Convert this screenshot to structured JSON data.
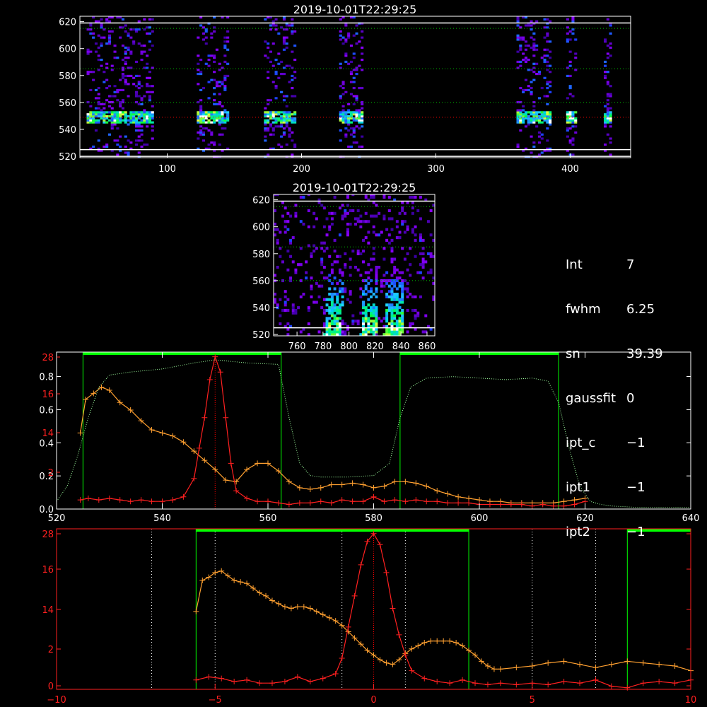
{
  "info_panel": [
    {
      "label": "Int",
      "value": "7"
    },
    {
      "label": "fwhm",
      "value": "6.25"
    },
    {
      "label": "sn",
      "value": "39.39"
    },
    {
      "label": "gaussfit",
      "value": "0"
    },
    {
      "label": "ipt_c",
      "value": "−1"
    },
    {
      "label": "ipt1",
      "value": "−1"
    },
    {
      "label": "ipt2",
      "value": "−1"
    }
  ],
  "colors": {
    "background": "#000000",
    "axes": "#ffffff",
    "grid": "#00c000",
    "red": "#ff2020",
    "orange": "#ffa030",
    "green": "#00ff00",
    "band": "#ff0000"
  },
  "chart_data": [
    {
      "type": "heatmap",
      "title": "2019-10-01T22:29:25",
      "xlim": [
        35,
        445
      ],
      "ylim": [
        519,
        624
      ],
      "xticks": [
        100,
        200,
        300,
        400
      ],
      "yticks": [
        520,
        540,
        560,
        580,
        600,
        620
      ],
      "hlines_white": [
        520,
        525,
        619
      ],
      "hlines_green_dotted": [
        560,
        585,
        615
      ],
      "hline_red_dotted": 549,
      "strips": [
        [
          40,
          90
        ],
        [
          122,
          146
        ],
        [
          172,
          196
        ],
        [
          228,
          246
        ],
        [
          360,
          386
        ],
        [
          397,
          404
        ],
        [
          425,
          430
        ]
      ],
      "core_y": [
        544,
        552
      ],
      "colormap": "rainbow"
    },
    {
      "type": "heatmap",
      "title": "2019-10-01T22:29:25",
      "xlim": [
        742,
        866
      ],
      "ylim": [
        519,
        624
      ],
      "xticks": [
        760,
        780,
        800,
        820,
        840,
        860
      ],
      "yticks": [
        520,
        540,
        560,
        580,
        600,
        620
      ],
      "hlines_white": [
        525,
        619
      ],
      "hlines_green_dotted": [
        560,
        585,
        615
      ],
      "bright_streaks": [
        [
          780,
          793
        ],
        [
          808,
          820
        ],
        [
          826,
          840
        ]
      ],
      "colormap": "rainbow"
    },
    {
      "type": "line",
      "xlim": [
        520,
        640
      ],
      "xticks": [
        520,
        540,
        560,
        580,
        600,
        620,
        640
      ],
      "yticks_left_white": [
        "0.0",
        "0.2",
        "0.4",
        "0.6",
        "0.8"
      ],
      "yticks_left_red": [
        "2",
        "14",
        "16",
        "28"
      ],
      "green_spans": [
        [
          525,
          562.5
        ],
        [
          585,
          615
        ]
      ],
      "green_span_top": 1.0,
      "band_center": 550,
      "series": [
        {
          "color": "orange",
          "marker": "plus",
          "x": [
            524.5,
            525.5,
            527,
            528.5,
            530,
            532,
            534,
            536,
            538,
            540,
            542,
            544,
            546,
            548,
            550,
            552,
            554,
            556,
            558,
            560,
            562,
            564,
            566,
            568,
            570,
            572,
            574,
            576,
            578,
            580,
            582,
            584,
            586,
            588,
            590,
            592,
            594,
            596,
            598,
            600,
            602,
            604,
            606,
            608,
            610,
            612,
            614,
            616,
            618,
            620
          ],
          "y": [
            0.5,
            0.72,
            0.76,
            0.8,
            0.78,
            0.7,
            0.65,
            0.58,
            0.52,
            0.5,
            0.48,
            0.44,
            0.38,
            0.32,
            0.26,
            0.19,
            0.18,
            0.26,
            0.3,
            0.3,
            0.25,
            0.18,
            0.14,
            0.13,
            0.14,
            0.16,
            0.16,
            0.17,
            0.16,
            0.14,
            0.15,
            0.18,
            0.18,
            0.17,
            0.15,
            0.12,
            0.1,
            0.08,
            0.07,
            0.06,
            0.05,
            0.05,
            0.04,
            0.04,
            0.04,
            0.04,
            0.04,
            0.05,
            0.06,
            0.07
          ]
        },
        {
          "color": "red",
          "marker": "plus",
          "x": [
            524.5,
            526,
            528,
            530,
            532,
            534,
            536,
            538,
            540,
            542,
            544,
            546,
            547,
            548,
            549,
            550,
            551,
            552,
            553,
            554,
            556,
            558,
            560,
            562,
            564,
            566,
            568,
            570,
            572,
            574,
            576,
            578,
            580,
            582,
            584,
            586,
            588,
            590,
            592,
            594,
            596,
            598,
            600,
            602,
            604,
            606,
            608,
            610,
            612,
            614,
            616,
            618,
            620
          ],
          "y": [
            0.06,
            0.07,
            0.06,
            0.07,
            0.06,
            0.05,
            0.06,
            0.05,
            0.05,
            0.06,
            0.08,
            0.2,
            0.4,
            0.6,
            0.85,
            1.0,
            0.9,
            0.6,
            0.3,
            0.12,
            0.07,
            0.05,
            0.05,
            0.04,
            0.03,
            0.04,
            0.04,
            0.05,
            0.04,
            0.06,
            0.05,
            0.05,
            0.08,
            0.05,
            0.06,
            0.05,
            0.06,
            0.05,
            0.05,
            0.04,
            0.04,
            0.04,
            0.03,
            0.03,
            0.03,
            0.03,
            0.03,
            0.02,
            0.03,
            0.02,
            0.02,
            0.03,
            0.05
          ]
        },
        {
          "color": "green",
          "style": "dotted",
          "x": [
            520,
            522,
            524,
            526,
            528,
            530,
            534,
            540,
            546,
            550,
            556,
            562,
            564,
            566,
            568,
            570,
            575,
            580,
            583,
            585,
            587,
            590,
            595,
            600,
            605,
            610,
            613,
            615,
            617,
            619,
            621,
            623,
            625,
            630,
            635,
            640
          ],
          "y": [
            0.05,
            0.15,
            0.35,
            0.6,
            0.8,
            0.88,
            0.9,
            0.92,
            0.96,
            0.98,
            0.96,
            0.95,
            0.6,
            0.3,
            0.22,
            0.21,
            0.21,
            0.22,
            0.3,
            0.6,
            0.8,
            0.86,
            0.87,
            0.86,
            0.85,
            0.86,
            0.84,
            0.7,
            0.4,
            0.15,
            0.05,
            0.03,
            0.02,
            0.01,
            0.01,
            0.01
          ]
        }
      ]
    },
    {
      "type": "line",
      "xlim": [
        -10,
        10
      ],
      "xticks": [
        -10,
        -5,
        0,
        5,
        10
      ],
      "yticks_left_red": [
        "0",
        "2",
        "14",
        "16",
        "28"
      ],
      "green_spans": [
        [
          -5.6,
          3
        ],
        [
          8,
          10
        ]
      ],
      "white_dotted_x": [
        -7,
        -5,
        -1,
        1,
        5,
        7
      ],
      "red_dotted_x": 0,
      "series": [
        {
          "color": "orange",
          "marker": "plus",
          "x": [
            -5.6,
            -5.4,
            -5.2,
            -5.0,
            -4.8,
            -4.6,
            -4.4,
            -4.2,
            -4.0,
            -3.8,
            -3.6,
            -3.4,
            -3.2,
            -3.0,
            -2.8,
            -2.6,
            -2.4,
            -2.2,
            -2.0,
            -1.8,
            -1.6,
            -1.4,
            -1.2,
            -1.0,
            -0.8,
            -0.6,
            -0.4,
            -0.2,
            0,
            0.2,
            0.4,
            0.6,
            0.8,
            1.0,
            1.2,
            1.4,
            1.6,
            1.8,
            2.0,
            2.2,
            2.4,
            2.6,
            2.8,
            3.0,
            3.2,
            3.4,
            3.6,
            3.8,
            4.0,
            4.5,
            5.0,
            5.5,
            6.0,
            6.5,
            7.0,
            7.5,
            8.0,
            8.5,
            9.0,
            9.5,
            10.0
          ],
          "y": [
            0.5,
            0.7,
            0.72,
            0.75,
            0.76,
            0.73,
            0.7,
            0.69,
            0.68,
            0.65,
            0.62,
            0.6,
            0.57,
            0.55,
            0.53,
            0.52,
            0.53,
            0.53,
            0.52,
            0.5,
            0.48,
            0.46,
            0.44,
            0.41,
            0.37,
            0.33,
            0.29,
            0.25,
            0.22,
            0.19,
            0.17,
            0.16,
            0.19,
            0.23,
            0.26,
            0.28,
            0.3,
            0.31,
            0.31,
            0.31,
            0.31,
            0.3,
            0.28,
            0.25,
            0.22,
            0.18,
            0.15,
            0.13,
            0.13,
            0.14,
            0.15,
            0.17,
            0.18,
            0.16,
            0.14,
            0.16,
            0.18,
            0.17,
            0.16,
            0.15,
            0.12
          ]
        },
        {
          "color": "red",
          "marker": "plus",
          "x": [
            -5.6,
            -5.2,
            -4.8,
            -4.4,
            -4.0,
            -3.6,
            -3.2,
            -2.8,
            -2.4,
            -2.0,
            -1.6,
            -1.2,
            -1.0,
            -0.8,
            -0.6,
            -0.4,
            -0.2,
            0,
            0.2,
            0.4,
            0.6,
            0.8,
            1.0,
            1.2,
            1.6,
            2.0,
            2.4,
            2.8,
            3.2,
            3.6,
            4.0,
            4.5,
            5.0,
            5.5,
            6.0,
            6.5,
            7.0,
            7.5,
            8.0,
            8.5,
            9.0,
            9.5,
            10.0
          ],
          "y": [
            0.06,
            0.08,
            0.07,
            0.05,
            0.06,
            0.04,
            0.04,
            0.05,
            0.08,
            0.05,
            0.07,
            0.1,
            0.2,
            0.4,
            0.6,
            0.8,
            0.95,
            1.0,
            0.93,
            0.75,
            0.52,
            0.35,
            0.22,
            0.12,
            0.07,
            0.05,
            0.04,
            0.06,
            0.04,
            0.03,
            0.04,
            0.03,
            0.04,
            0.03,
            0.05,
            0.04,
            0.06,
            0.02,
            0.01,
            0.04,
            0.05,
            0.04,
            0.06
          ]
        }
      ]
    }
  ]
}
